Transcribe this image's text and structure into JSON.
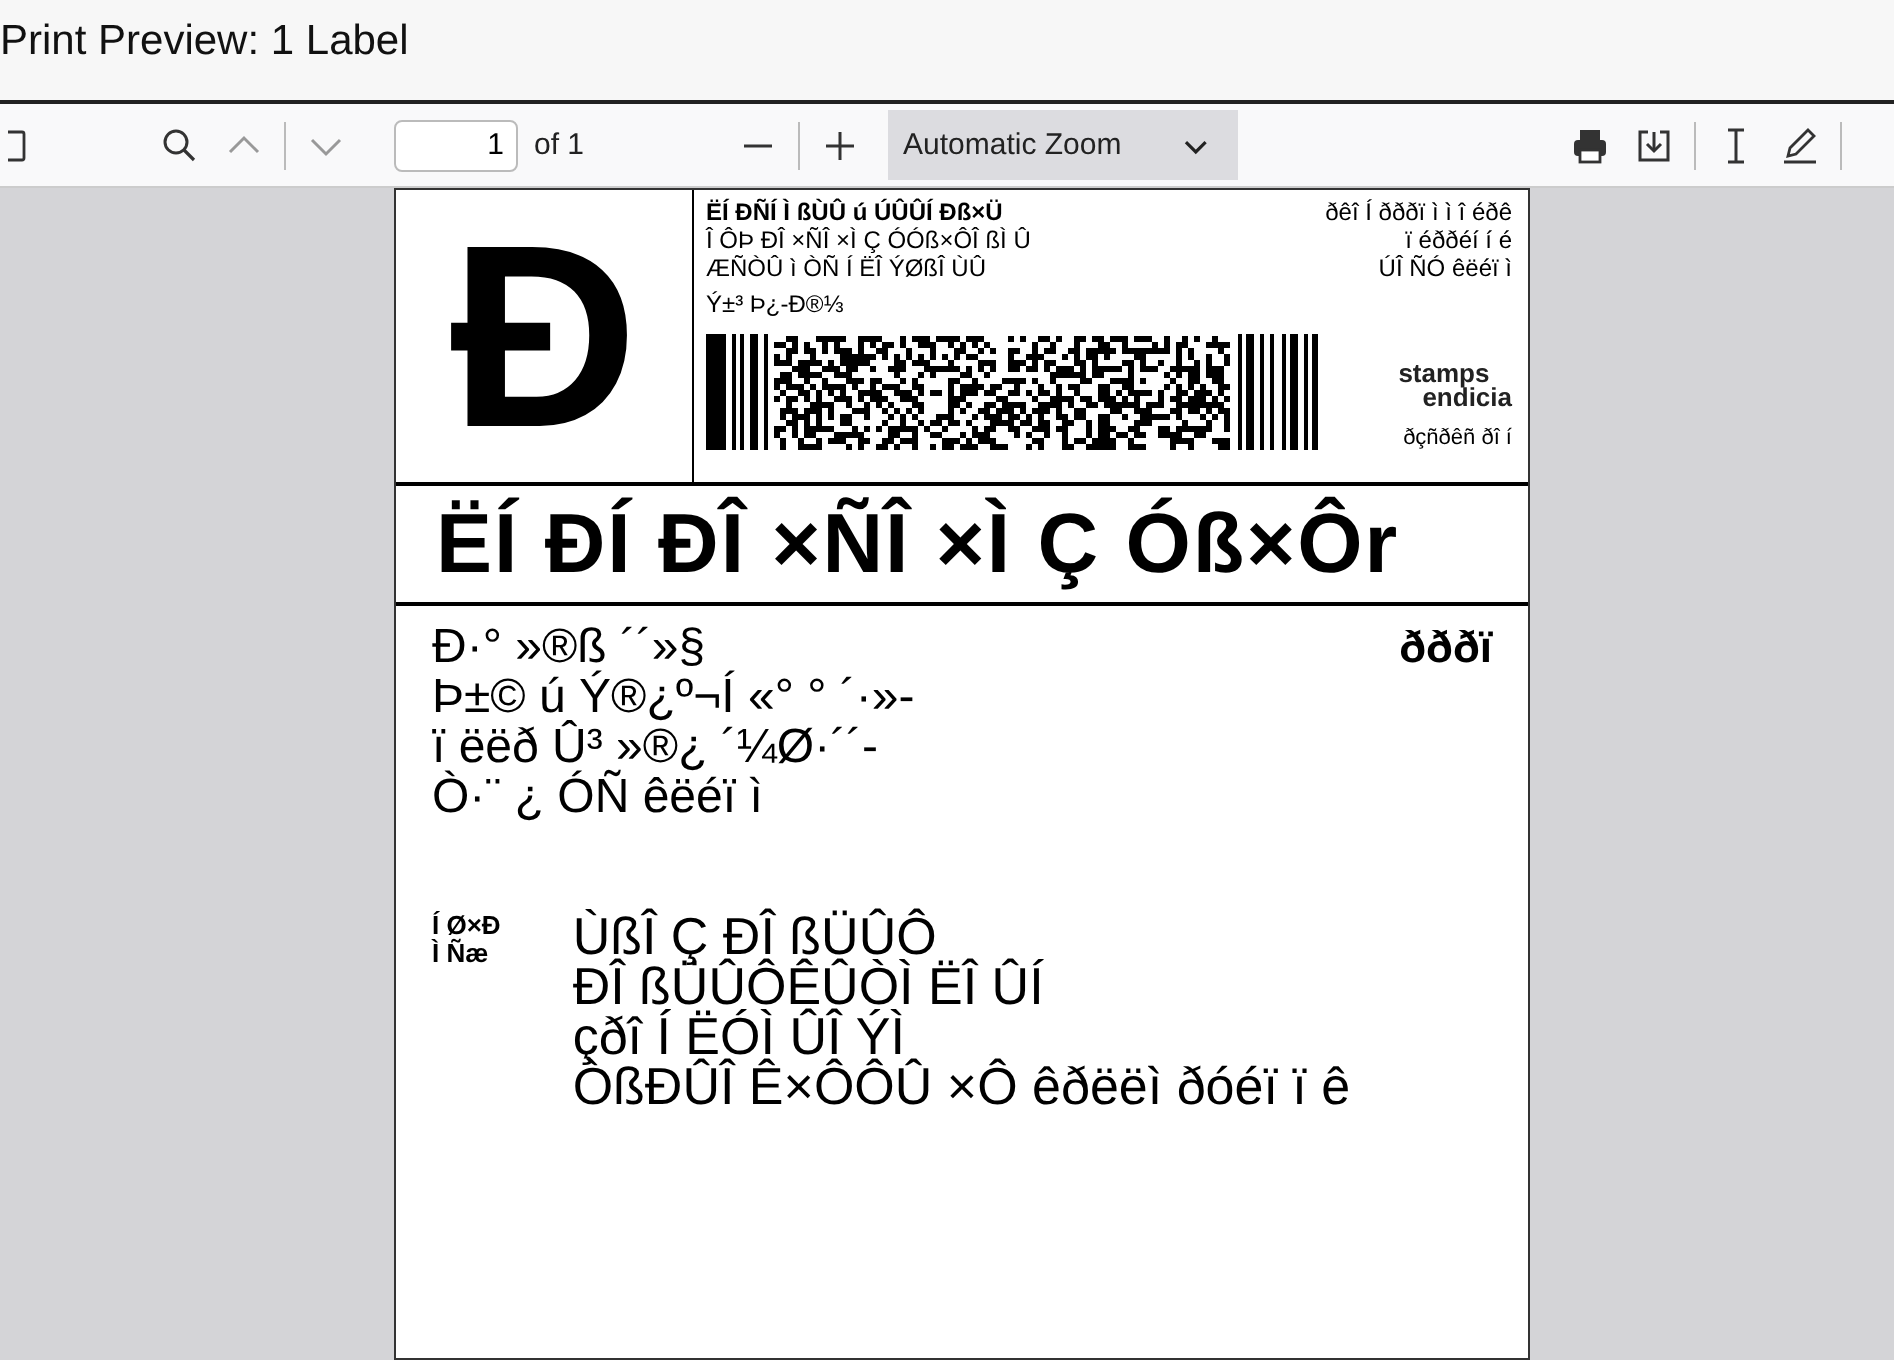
{
  "window": {
    "title": "Print Preview: 1 Label"
  },
  "toolbar": {
    "page_input": "1",
    "page_count": "of 1",
    "zoom": "Automatic Zoom"
  },
  "label": {
    "service_mark": "Ð",
    "header_left": [
      "ËÍ  ÐÑÍ Ì ßÙÛ ú ÚÛÛÍ  Ðß×Ü",
      "Î ÔÞ ÐÎ ×ÑÎ ×Ì Ç ÓÓß×ÔÎ ßÌ Û",
      "ÆÑÒÛ ì ÒÑ Í ËÎ ÝØßÎ ÙÛ",
      "Ý±³  Þ¿-Ð®⅓"
    ],
    "header_right": [
      "ðêî Í ðððï ì ì î éðê",
      "ï éððéí í é",
      "ÚÎ ÑÓ êëéï ì"
    ],
    "brand": [
      "stamps",
      "endicia"
    ],
    "brand_code": "ðçñðêñ ðî í",
    "service_title": "ËÍ ÐÍ  ÐÎ ×ÑÎ ×Ì Ç Óß×Ôr",
    "from_lines": [
      "Ð·° »®ß ´´»§",
      "Þ±© ú Ý®¿º¬Í  «° ° ´·»-",
      "ï ëëð Û³  »®¿ ´¼Ø·´´-",
      "Ò·¨ ¿ ÓÑ êëéï ì"
    ],
    "from_code": "ðððï",
    "ship_to_label": [
      "Í Ø×Ð",
      "Ì Ñæ"
    ],
    "to_lines": [
      "ÙßÎ Ç ÐÎ ßÜÛÔ",
      "ÐÎ ßÜÛÔÊÛÒÌ ËÎ ÛÍ",
      "çðî  Í ËÓÌ ÛÎ  ÝÌ",
      "ÒßÐÛÎ Ê×ÔÔÛ ×Ô êðëëì ðóéï ï ê"
    ]
  }
}
